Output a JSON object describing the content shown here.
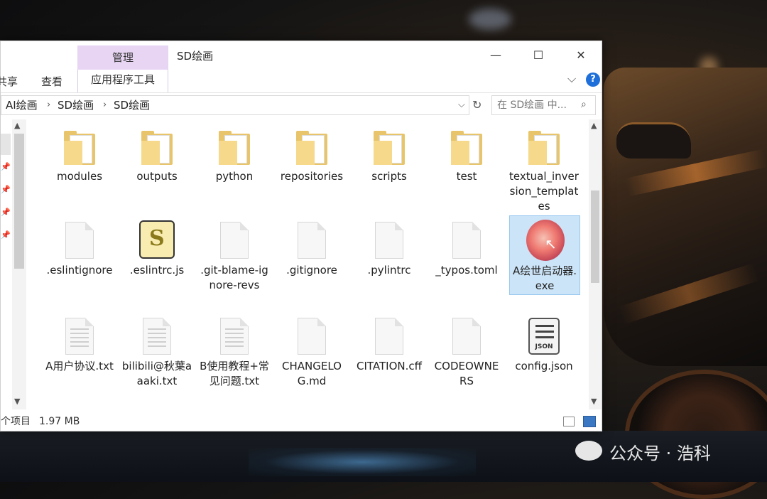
{
  "window": {
    "title": "SD绘画",
    "manage_tab": "管理",
    "controls": {
      "minimize": "—",
      "maximize": "☐",
      "close": "✕"
    }
  },
  "ribbon": {
    "tabs": [
      "共享",
      "查看"
    ],
    "app_tools": "应用程序工具",
    "help": "?",
    "collapse": "⌵"
  },
  "address": {
    "crumbs": [
      "AI绘画",
      "SD绘画",
      "SD绘画"
    ],
    "separator": "›",
    "dropdown": "⌵",
    "refresh": "↻",
    "search_placeholder": "在 SD绘画 中...",
    "search_icon": "⌕"
  },
  "icons": {
    "pin": "📌",
    "scroll_up": "▲",
    "scroll_down": "▼",
    "cursor": "↖",
    "scroll_glyph": "S",
    "json_tag": "JSON"
  },
  "items": [
    {
      "name": "modules",
      "type": "folder"
    },
    {
      "name": "outputs",
      "type": "folder"
    },
    {
      "name": "python",
      "type": "folder"
    },
    {
      "name": "repositories",
      "type": "folder"
    },
    {
      "name": "scripts",
      "type": "folder"
    },
    {
      "name": "test",
      "type": "folder"
    },
    {
      "name": "textual_inversion_templates",
      "type": "folder"
    },
    {
      "name": ".eslintignore",
      "type": "file"
    },
    {
      "name": ".eslintrc.js",
      "type": "script"
    },
    {
      "name": ".git-blame-ignore-revs",
      "type": "file"
    },
    {
      "name": ".gitignore",
      "type": "file"
    },
    {
      "name": ".pylintrc",
      "type": "file"
    },
    {
      "name": "_typos.toml",
      "type": "file"
    },
    {
      "name": "A绘世启动器.exe",
      "type": "exe",
      "selected": true
    },
    {
      "name": "A用户协议.txt",
      "type": "txt"
    },
    {
      "name": "bilibili@秋葉aaaki.txt",
      "type": "txt"
    },
    {
      "name": "B使用教程+常见问题.txt",
      "type": "txt"
    },
    {
      "name": "CHANGELOG.md",
      "type": "file"
    },
    {
      "name": "CITATION.cff",
      "type": "file"
    },
    {
      "name": "CODEOWNERS",
      "type": "file"
    },
    {
      "name": "config.json",
      "type": "json"
    }
  ],
  "status": {
    "count": "个项目",
    "size": "1.97 MB"
  },
  "watermark": {
    "text": "公众号 · 浩科"
  },
  "colors": {
    "manage_tab": "#e7d5f3",
    "selection": "#cce4f7",
    "folder": "#e8c56a",
    "help": "#1e6fd9"
  }
}
